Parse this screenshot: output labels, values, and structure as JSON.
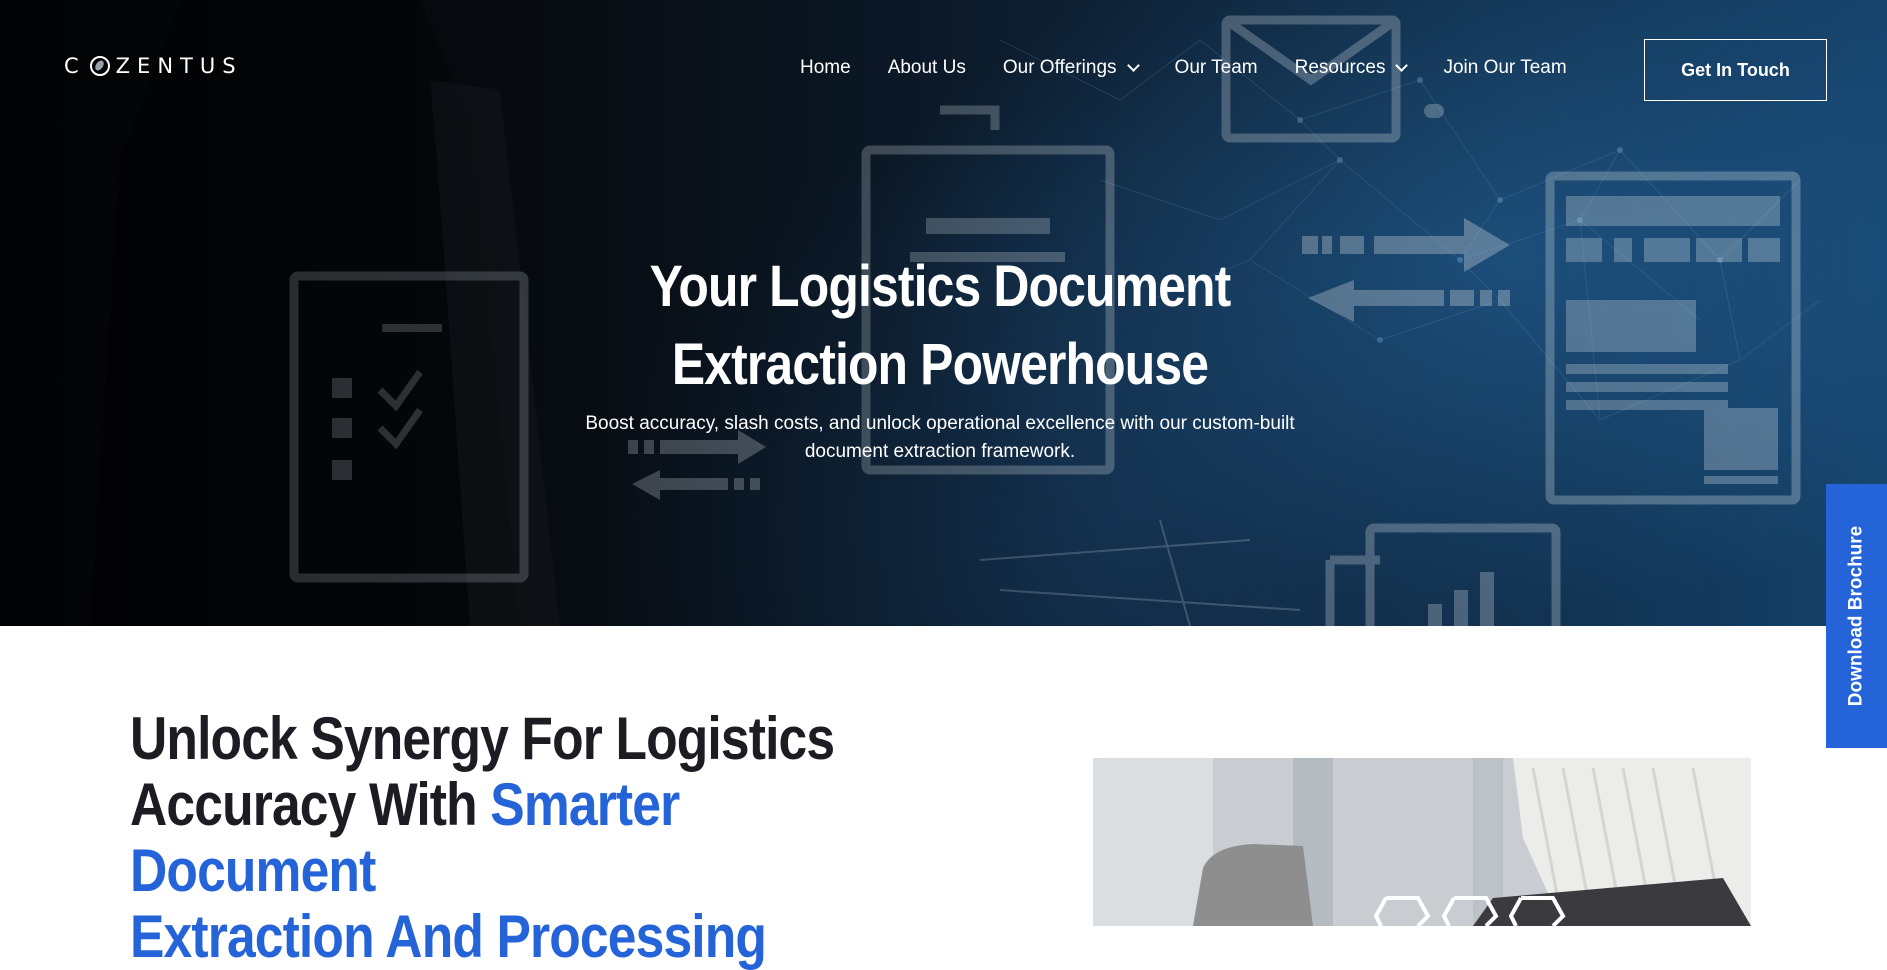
{
  "brand": {
    "logo_text_left": "C",
    "logo_text_right": "ZENTUS"
  },
  "nav": {
    "items": [
      {
        "label": "Home",
        "has_dropdown": false
      },
      {
        "label": "About Us",
        "has_dropdown": false
      },
      {
        "label": "Our Offerings",
        "has_dropdown": true
      },
      {
        "label": "Our Team",
        "has_dropdown": false
      },
      {
        "label": "Resources",
        "has_dropdown": true
      },
      {
        "label": "Join Our Team",
        "has_dropdown": false
      }
    ],
    "cta_label": "Get In Touch"
  },
  "hero": {
    "title_line1": "Your Logistics Document",
    "title_line2": "Extraction Powerhouse",
    "subtitle_line1": "Boost accuracy, slash costs, and unlock operational excellence with our custom-built",
    "subtitle_line2": "document extraction framework."
  },
  "side_tab": {
    "label": "Download Brochure"
  },
  "section": {
    "title_part1": "Unlock Synergy For Logistics",
    "title_part2": "Accuracy With ",
    "title_accent1": "Smarter Document",
    "title_accent2": "Extraction And Processing"
  },
  "colors": {
    "accent": "#2563d9",
    "heading_dark": "#1c1c22",
    "hero_bg": "#10263d"
  }
}
